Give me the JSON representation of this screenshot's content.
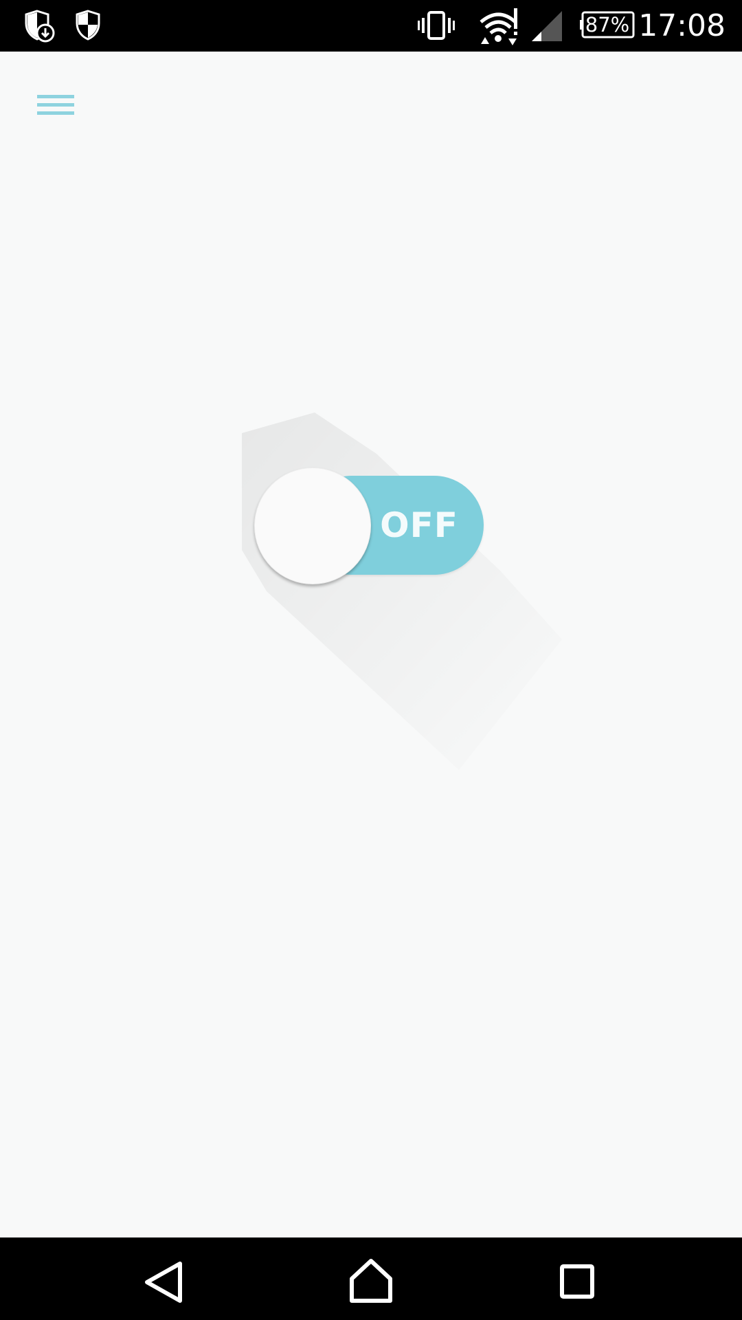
{
  "status_bar": {
    "icons": [
      "shield-download-icon",
      "security-shield-icon",
      "vibrate-icon",
      "wifi-alert-icon",
      "cell-signal-icon",
      "battery-icon"
    ],
    "battery_percent": "87%",
    "time": "17:08"
  },
  "toolbar": {
    "menu_icon": "hamburger-menu-icon",
    "accent_color": "#8ed3df"
  },
  "toggle": {
    "label": "OFF",
    "state": "off",
    "track_color": "#7fcfdc",
    "knob_color": "#fafafa"
  },
  "nav_bar": {
    "icons": [
      "back-icon",
      "home-icon",
      "recents-icon"
    ]
  }
}
